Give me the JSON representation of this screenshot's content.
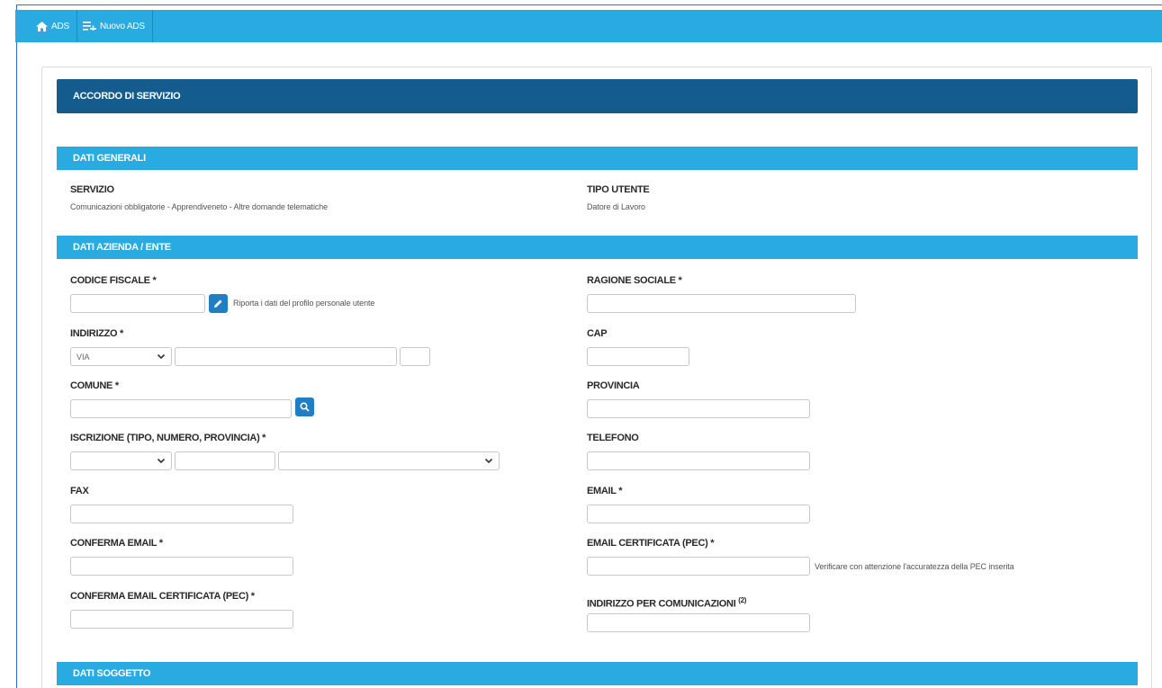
{
  "nav": {
    "home_label": "ADS",
    "new_label": "Nuovo ADS"
  },
  "header": {
    "title": "ACCORDO DI SERVIZIO"
  },
  "sections": {
    "general": "DATI GENERALI",
    "company": "DATI AZIENDA / ENTE",
    "subject": "DATI SOGGETTO"
  },
  "general": {
    "service_label": "SERVIZIO",
    "service_value": "Comunicazioni obbligatorie - Apprendiveneto - Altre domande telematiche",
    "user_type_label": "TIPO UTENTE",
    "user_type_value": "Datore di Lavoro"
  },
  "company": {
    "fiscal_code_label": "CODICE FISCALE *",
    "fiscal_code_value": "",
    "copy_profile_hint": "Riporta i dati del profilo personale utente",
    "business_name_label": "RAGIONE SOCIALE *",
    "business_name_value": "",
    "address_label": "INDIRIZZO *",
    "address_type_value": "VIA",
    "address_street_value": "",
    "address_number_value": "",
    "cap_label": "CAP",
    "cap_value": "",
    "municipality_label": "COMUNE *",
    "municipality_value": "",
    "province_label": "PROVINCIA",
    "province_value": "",
    "registration_label": "ISCRIZIONE (TIPO, NUMERO, PROVINCIA) *",
    "registration_type_value": "",
    "registration_number_value": "",
    "registration_province_value": "",
    "phone_label": "TELEFONO",
    "phone_value": "",
    "fax_label": "FAX",
    "fax_value": "",
    "email_label": "EMAIL *",
    "email_value": "",
    "confirm_email_label": "CONFERMA EMAIL *",
    "confirm_email_value": "",
    "pec_label": "EMAIL CERTIFICATA (PEC) *",
    "pec_value": "",
    "pec_hint": "Verificare con attenzione l'accuratezza della PEC inserita",
    "confirm_pec_label": "CONFERMA EMAIL CERTIFICATA (PEC) *",
    "confirm_pec_value": "",
    "comm_address_label": "INDIRIZZO PER COMUNICAZIONI",
    "comm_address_sup": "(2)",
    "comm_address_value": ""
  },
  "icons": {
    "home": "home-icon",
    "new": "add-list-icon",
    "edit": "pencil-icon",
    "search": "search-icon",
    "chevron": "chevron-down-icon"
  },
  "colors": {
    "topbar": "#29abe2",
    "header": "#145b8e",
    "section": "#29abe2",
    "button": "#1f7ec4"
  }
}
